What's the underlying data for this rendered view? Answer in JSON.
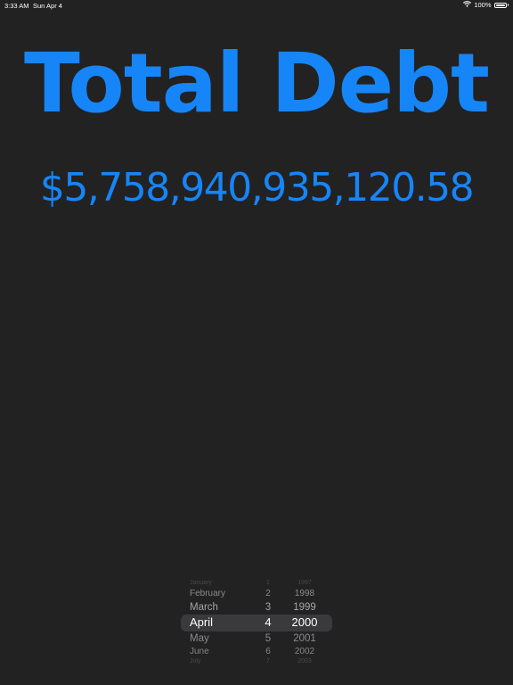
{
  "status_bar": {
    "time": "3:33 AM",
    "date": "Sun Apr 4",
    "battery_percent": "100%",
    "battery_level": 1.0,
    "wifi_icon": "wifi-icon",
    "battery_icon": "battery-icon"
  },
  "title": "Total Debt",
  "amount": "$5,758,940,935,120.58",
  "colors": {
    "accent": "#1685f8",
    "background": "#222222"
  },
  "date_picker": {
    "rows": [
      {
        "month": "January",
        "day": "1",
        "year": "1997"
      },
      {
        "month": "February",
        "day": "2",
        "year": "1998"
      },
      {
        "month": "March",
        "day": "3",
        "year": "1999"
      },
      {
        "month": "April",
        "day": "4",
        "year": "2000"
      },
      {
        "month": "May",
        "day": "5",
        "year": "2001"
      },
      {
        "month": "June",
        "day": "6",
        "year": "2002"
      },
      {
        "month": "July",
        "day": "7",
        "year": "2003"
      }
    ],
    "selected_index": 3
  }
}
